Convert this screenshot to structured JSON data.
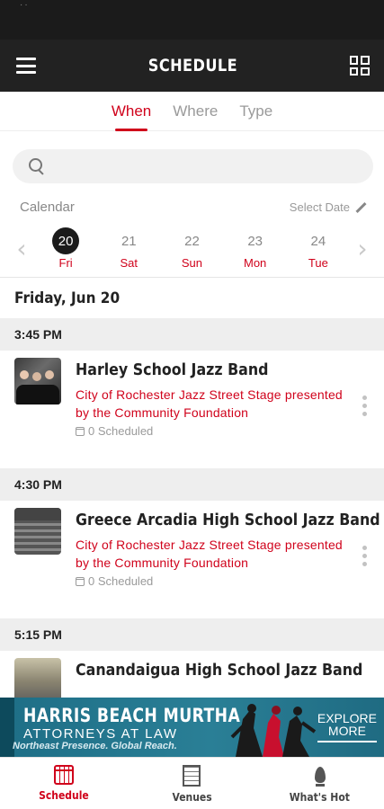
{
  "header": {
    "title": "SCHEDULE"
  },
  "tabs": [
    {
      "label": "When",
      "active": true
    },
    {
      "label": "Where",
      "active": false
    },
    {
      "label": "Type",
      "active": false
    }
  ],
  "search": {
    "value": "",
    "placeholder": ""
  },
  "calendar": {
    "label": "Calendar",
    "select_date_label": "Select Date",
    "days": [
      {
        "num": "20",
        "name": "Fri",
        "selected": true
      },
      {
        "num": "21",
        "name": "Sat",
        "selected": false
      },
      {
        "num": "22",
        "name": "Sun",
        "selected": false
      },
      {
        "num": "23",
        "name": "Mon",
        "selected": false
      },
      {
        "num": "24",
        "name": "Tue",
        "selected": false
      }
    ]
  },
  "date_heading": "Friday, Jun 20",
  "groups": [
    {
      "time": "3:45 PM",
      "events": [
        {
          "title": "Harley School Jazz Band",
          "venue": "City of Rochester Jazz Street Stage presented by the Community Foundation",
          "scheduled": "0 Scheduled"
        }
      ]
    },
    {
      "time": "4:30 PM",
      "events": [
        {
          "title": "Greece Arcadia High School Jazz Band",
          "venue": "City of Rochester Jazz Street Stage presented by the Community Foundation",
          "scheduled": "0 Scheduled"
        }
      ]
    },
    {
      "time": "5:15 PM",
      "events": [
        {
          "title": "Canandaigua High School  Jazz Band",
          "venue": "",
          "scheduled": ""
        }
      ]
    }
  ],
  "ad": {
    "title": "HARRIS BEACH MURTHA",
    "subtitle": "ATTORNEYS AT LAW",
    "tagline": "Northeast Presence. Global Reach.",
    "cta_line1": "EXPLORE",
    "cta_line2": "MORE",
    "colors": {
      "background": "#2a7f96",
      "text": "#ffffff"
    }
  },
  "bottom_nav": [
    {
      "label": "Schedule",
      "icon": "calendar-icon",
      "active": true
    },
    {
      "label": "Venues",
      "icon": "building-icon",
      "active": false
    },
    {
      "label": "What's Hot",
      "icon": "flame-icon",
      "active": false
    }
  ],
  "colors": {
    "accent": "#d0021b",
    "app_bar": "#222222",
    "section_header": "#eeeeee"
  }
}
